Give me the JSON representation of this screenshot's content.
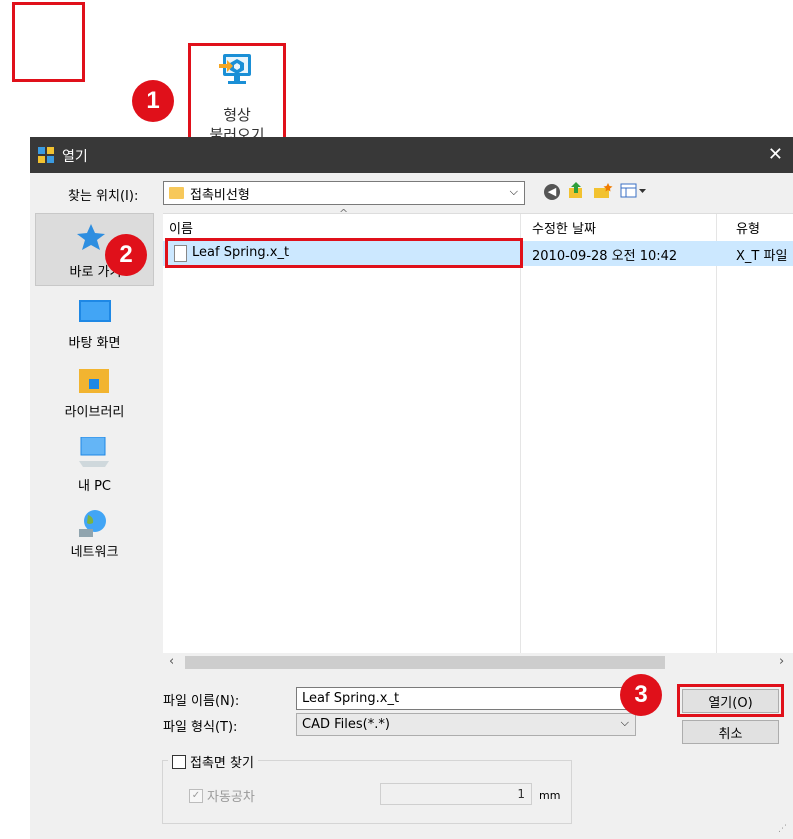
{
  "toolbar": {
    "shape_load_label_line1": "형상",
    "shape_load_label_line2": "불러오기"
  },
  "badges": {
    "one": "1",
    "two": "2",
    "three": "3"
  },
  "dialog": {
    "title": "열기",
    "close_glyph": "✕",
    "look_in_label": "찾는 위치(I):",
    "look_in_value": "접촉비선형",
    "places": [
      {
        "label": "바로 가기"
      },
      {
        "label": "바탕 화면"
      },
      {
        "label": "라이브러리"
      },
      {
        "label": "내 PC"
      },
      {
        "label": "네트워크"
      }
    ],
    "columns": {
      "name": "이름",
      "modified": "수정한 날짜",
      "type": "유형"
    },
    "files": [
      {
        "name": "Leaf Spring.x_t",
        "modified": "2010-09-28 오전 10:42",
        "type": "X_T 파일"
      }
    ],
    "filename_label": "파일 이름(N):",
    "filename_value": "Leaf Spring.x_t",
    "filetype_label": "파일 형식(T):",
    "filetype_value": "CAD Files(*.*)",
    "open_button": "열기(O)",
    "cancel_button": "취소",
    "contact_label": "접촉면 찾기",
    "auto_tol_label": "자동공차",
    "tolerance_value": "1",
    "tolerance_unit": "mm"
  },
  "colors": {
    "accent_red": "#e0101a",
    "selection": "#cce8ff",
    "titlebar": "#383838"
  }
}
